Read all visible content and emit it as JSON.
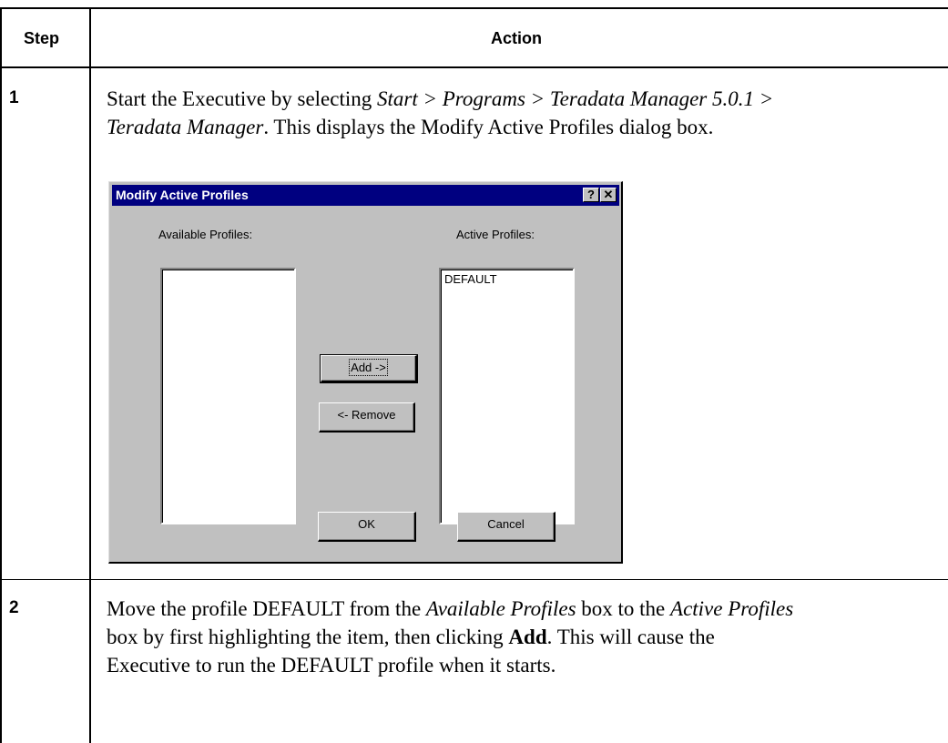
{
  "header": {
    "step": "Step",
    "action": "Action"
  },
  "steps": [
    {
      "number": "1",
      "line1_a": "Start the Executive by selecting ",
      "line1_i": "Start > Programs > Teradata Manager 5.0.1 >",
      "line2_i": "Teradata Manager",
      "line2_b": ". This displays the Modify Active Profiles dialog box."
    },
    {
      "number": "2",
      "line1_a": "Move the profile DEFAULT from the ",
      "line1_i1": "Available Profiles",
      "line1_b": " box to the ",
      "line1_i2": "Active Profiles",
      "line2_a": "box by first highlighting the item, then clicking ",
      "line2_bold": "Add",
      "line2_b": ". This will cause the",
      "line3": "Executive to run the DEFAULT profile when it starts."
    }
  ],
  "dialog": {
    "title": "Modify Active Profiles",
    "help_glyph": "?",
    "close_glyph": "✕",
    "available_label": "Available Profiles:",
    "active_label": "Active Profiles:",
    "active_items": [
      "DEFAULT"
    ],
    "add_button": "Add ->",
    "remove_button": "<- Remove",
    "ok_button": "OK",
    "cancel_button": "Cancel"
  }
}
